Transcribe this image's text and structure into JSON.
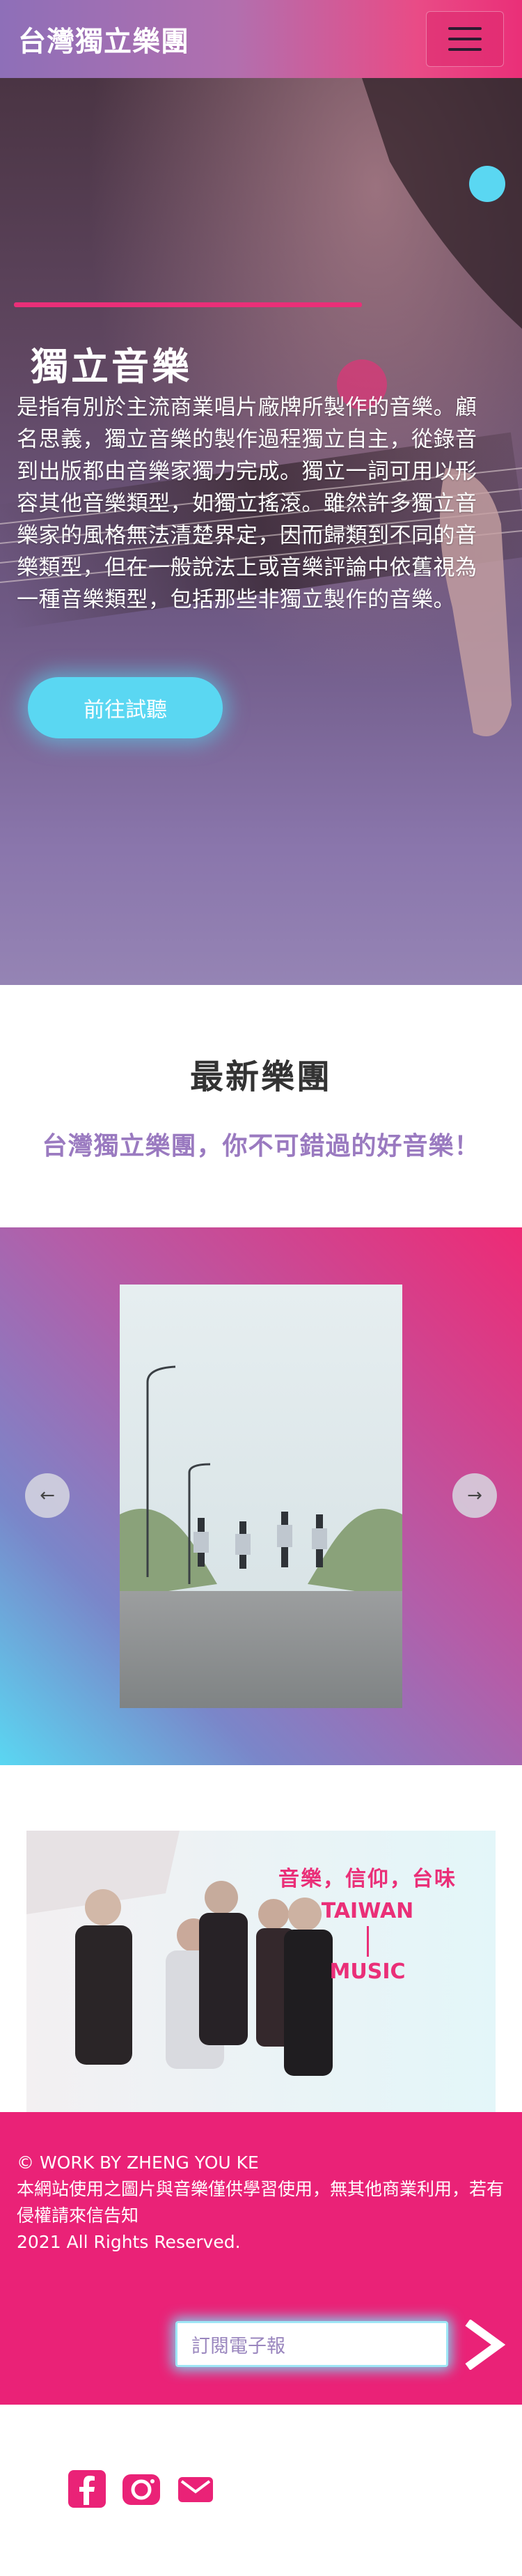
{
  "header": {
    "brand": "台灣獨立樂團"
  },
  "hero": {
    "title": "獨立音樂",
    "text": "是指有別於主流商業唱片廠牌所製作的音樂。顧名思義，獨立音樂的製作過程獨立自主，從錄音到出版都由音樂家獨力完成。獨立一詞可用以形容其他音樂類型，如獨立搖滾。雖然許多獨立音樂家的風格無法清楚界定，因而歸類到不同的音樂類型，但在一般說法上或音樂評論中依舊視為一種音樂類型，包括那些非獨立製作的音樂。",
    "button_label": "前往試聽"
  },
  "latest": {
    "title": "最新樂團",
    "subtitle": "台灣獨立樂團，你不可錯過的好音樂！"
  },
  "carousel": {
    "prev_glyph": "←",
    "next_glyph": "→"
  },
  "promo": {
    "slogan_line1": "音樂，信仰，台味",
    "slogan_line2": "TAIWAN",
    "slogan_line3": "MUSIC"
  },
  "footer": {
    "credit": "© WORK BY ZHENG YOU KE",
    "notice": "本網站使用之圖片與音樂僅供學習使用，無其他商業利用，若有侵權請來信告知",
    "rights": "2021 All Rights Reserved.",
    "newsletter_placeholder": "訂閱電子報"
  },
  "social": {
    "icons": [
      "facebook-icon",
      "instagram-icon",
      "mail-icon"
    ]
  },
  "colors": {
    "brand_pink": "#ea2277",
    "accent_cyan": "#5ad7f2",
    "subtitle_purple": "#9a7ac0"
  }
}
